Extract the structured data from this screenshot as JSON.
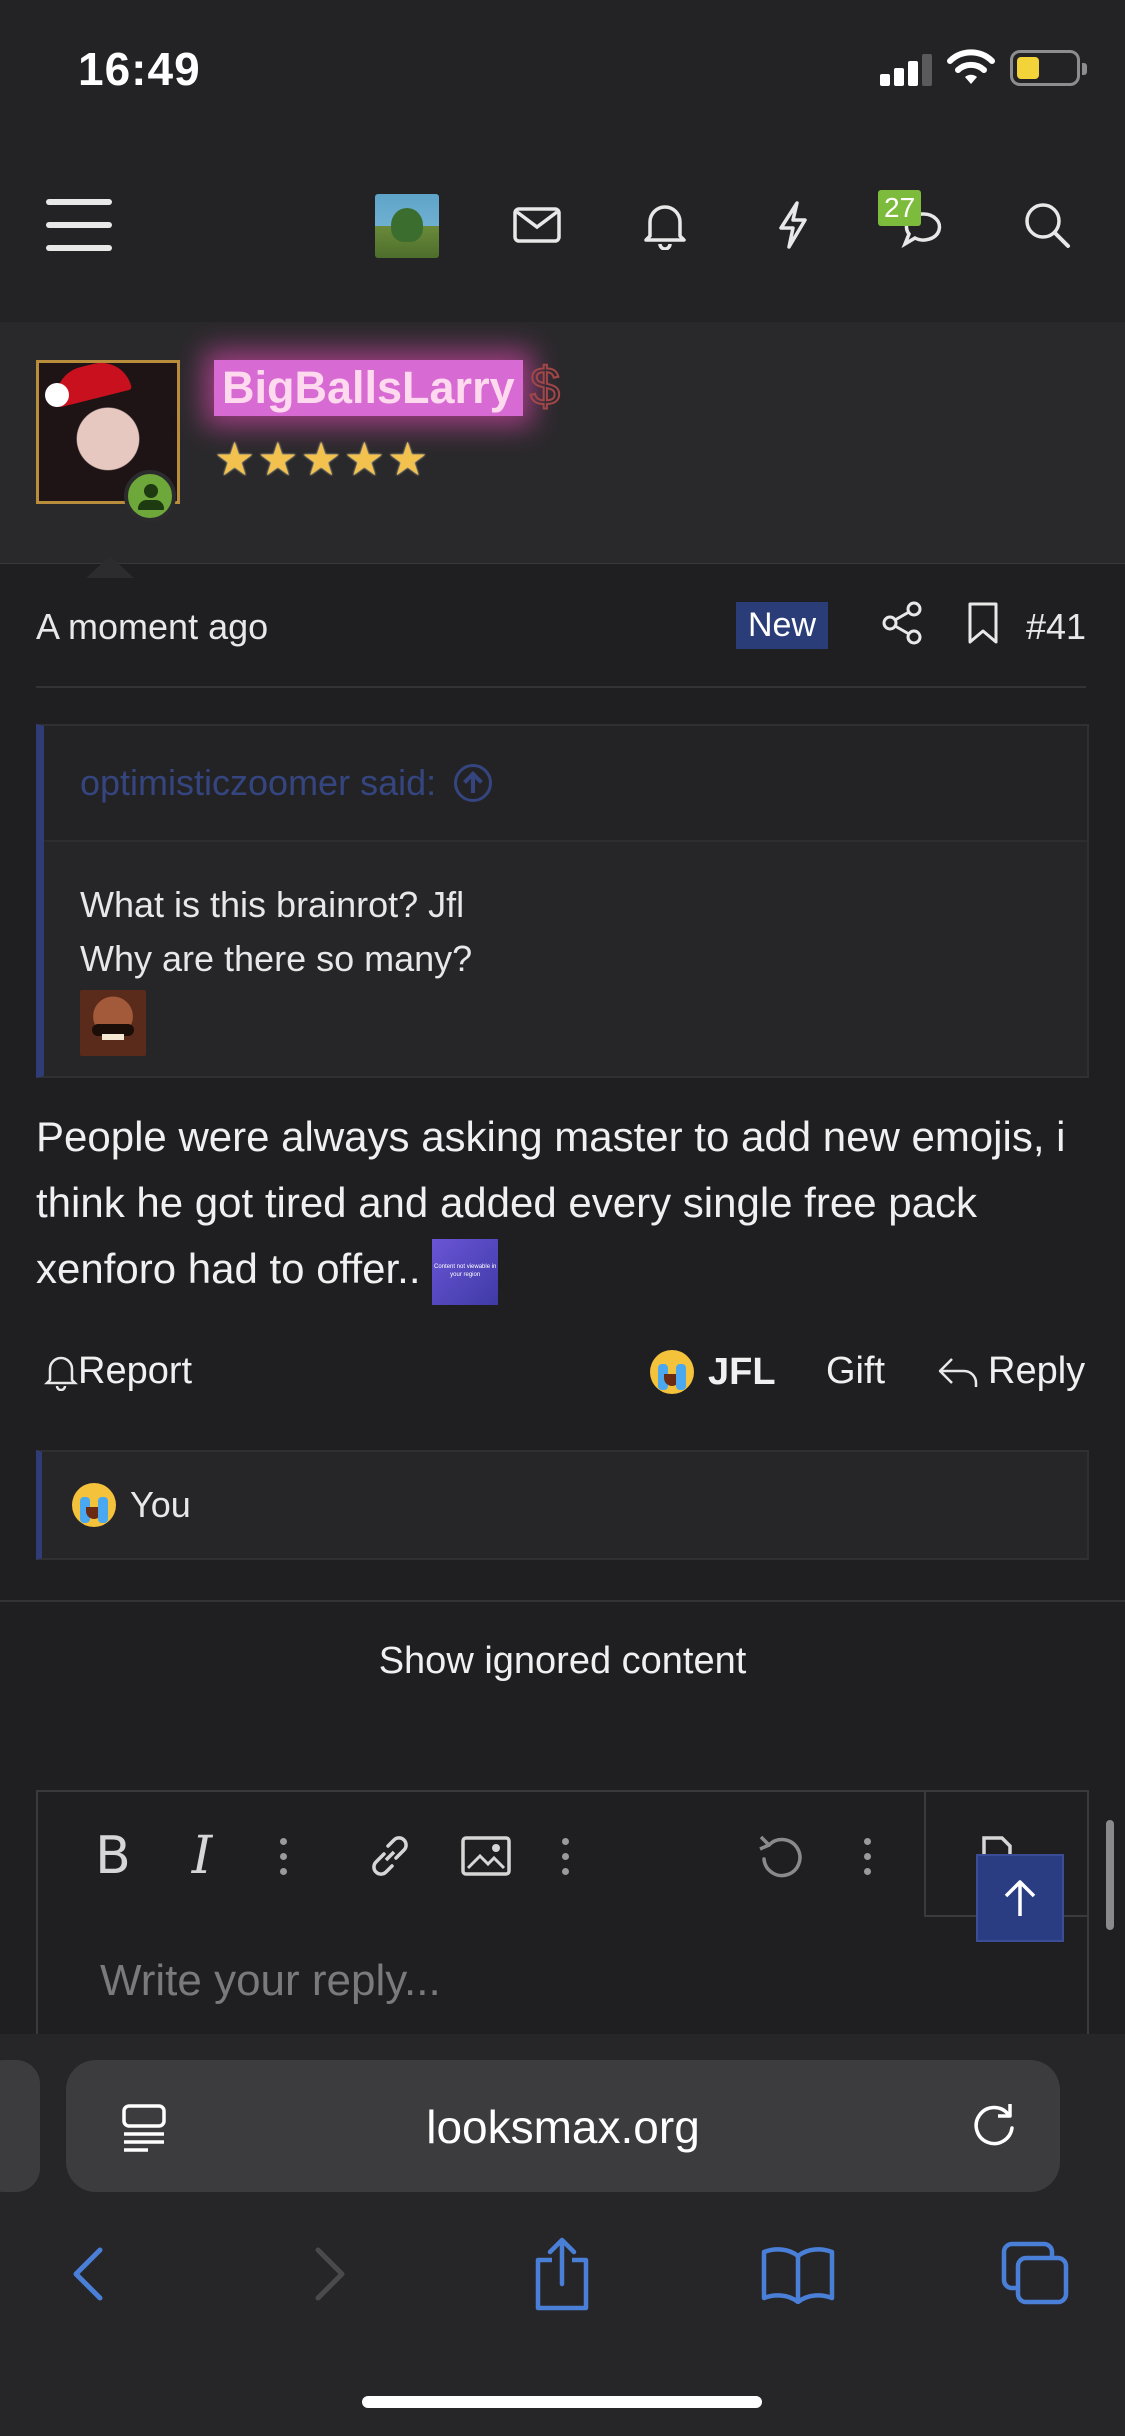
{
  "status_bar": {
    "time": "16:49"
  },
  "nav": {
    "items": [
      "menu-icon",
      "avatar",
      "mail-icon",
      "bell-icon",
      "bolt-icon",
      "chat-icon",
      "search-icon"
    ],
    "chat_badge": "27"
  },
  "profile": {
    "username": "BigBallsLarry",
    "rank_symbol": "$",
    "stars": "★★★★★",
    "colors": {
      "username_bg": "#d86ad3",
      "stars": "#f2c14e",
      "online": "#6fa83a"
    }
  },
  "post": {
    "time": "A moment ago",
    "new_label": "New",
    "number": "#41",
    "quote": {
      "author": "optimisticzoomer said:",
      "lines": [
        "What is this brainrot? Jfl",
        "Why are there so many?"
      ]
    },
    "message": "People were always asking master to add new emojis, i think he got tired and added every single free pack xenforo had to offer..",
    "inline_image_text": "Content not viewable in your region",
    "actions": {
      "report": "Report",
      "reaction": "JFL",
      "gift": "Gift",
      "reply": "Reply"
    },
    "reactions_summary": "You"
  },
  "show_ignored": "Show ignored content",
  "editor": {
    "placeholder": "Write your reply..."
  },
  "browser": {
    "url": "looksmax.org"
  },
  "accent": "#2a3d79"
}
